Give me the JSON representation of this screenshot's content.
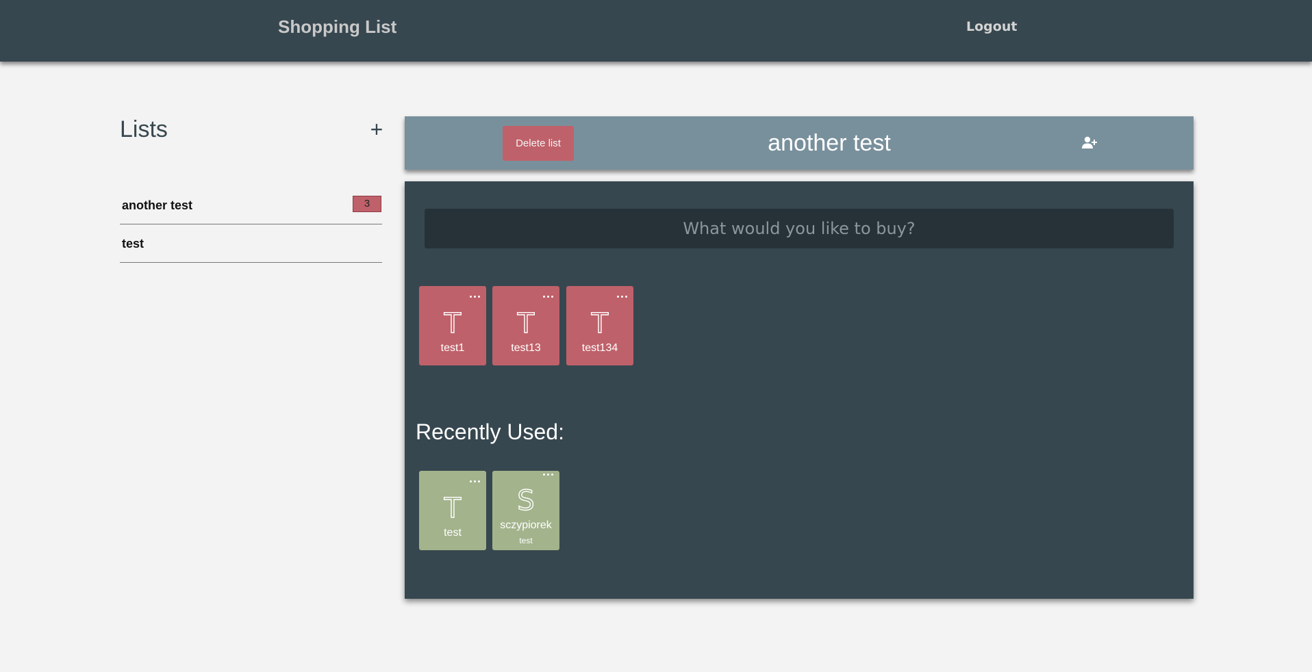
{
  "app": {
    "title": "Shopping List",
    "logout_label": "Logout"
  },
  "sidebar": {
    "heading": "Lists",
    "add_icon": "plus-icon",
    "lists": [
      {
        "name": "another test",
        "count": "3"
      },
      {
        "name": "test"
      }
    ]
  },
  "list_header": {
    "delete_label": "Delete list",
    "title": "another test",
    "share_icon": "user-plus-icon"
  },
  "main": {
    "search_placeholder": "What would you like to buy?",
    "items": [
      {
        "letter": "T",
        "label": "test1"
      },
      {
        "letter": "T",
        "label": "test13"
      },
      {
        "letter": "T",
        "label": "test134"
      }
    ],
    "recent_heading": "Recently Used:",
    "recent_items": [
      {
        "letter": "T",
        "label": "test"
      },
      {
        "letter": "S",
        "label": "sczypiorek",
        "sub": "test"
      }
    ]
  },
  "colors": {
    "topbar": "#37474f",
    "header_card": "#78909c",
    "accent_red": "#bf616a",
    "accent_green": "#a3b38c",
    "search_bg": "#263238",
    "page_bg": "#f3f3f3"
  }
}
